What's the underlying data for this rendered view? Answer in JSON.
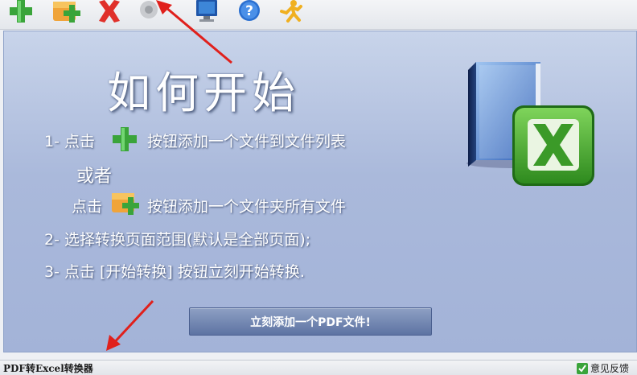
{
  "page": {
    "title": "如何开始",
    "steps": {
      "step1_prefix": "1- 点击",
      "step1_suffix": "按钮添加一个文件到文件列表",
      "or": "或者",
      "step1b_prefix": "点击",
      "step1b_suffix": "按钮添加一个文件夹所有文件",
      "step2": "2- 选择转换页面范围(默认是全部页面);",
      "step3": "3- 点击 [开始转换] 按钮立刻开始转换."
    },
    "add_pdf_button": "立刻添加一个PDF文件!"
  },
  "toolbar": {
    "icons": [
      "add-file-icon",
      "add-folder-icon",
      "delete-icon",
      "settings-icon",
      "monitor-icon",
      "help-icon",
      "run-icon"
    ]
  },
  "statusbar": {
    "app_name": "PDF转Excel转换器",
    "feedback": "意见反馈"
  },
  "colors": {
    "panel_top": "#c8d4ea",
    "panel_bottom": "#a3b3d8",
    "button": "#6a80ae",
    "excel_green": "#3c9a2c",
    "arrow_red": "#e0201c"
  }
}
